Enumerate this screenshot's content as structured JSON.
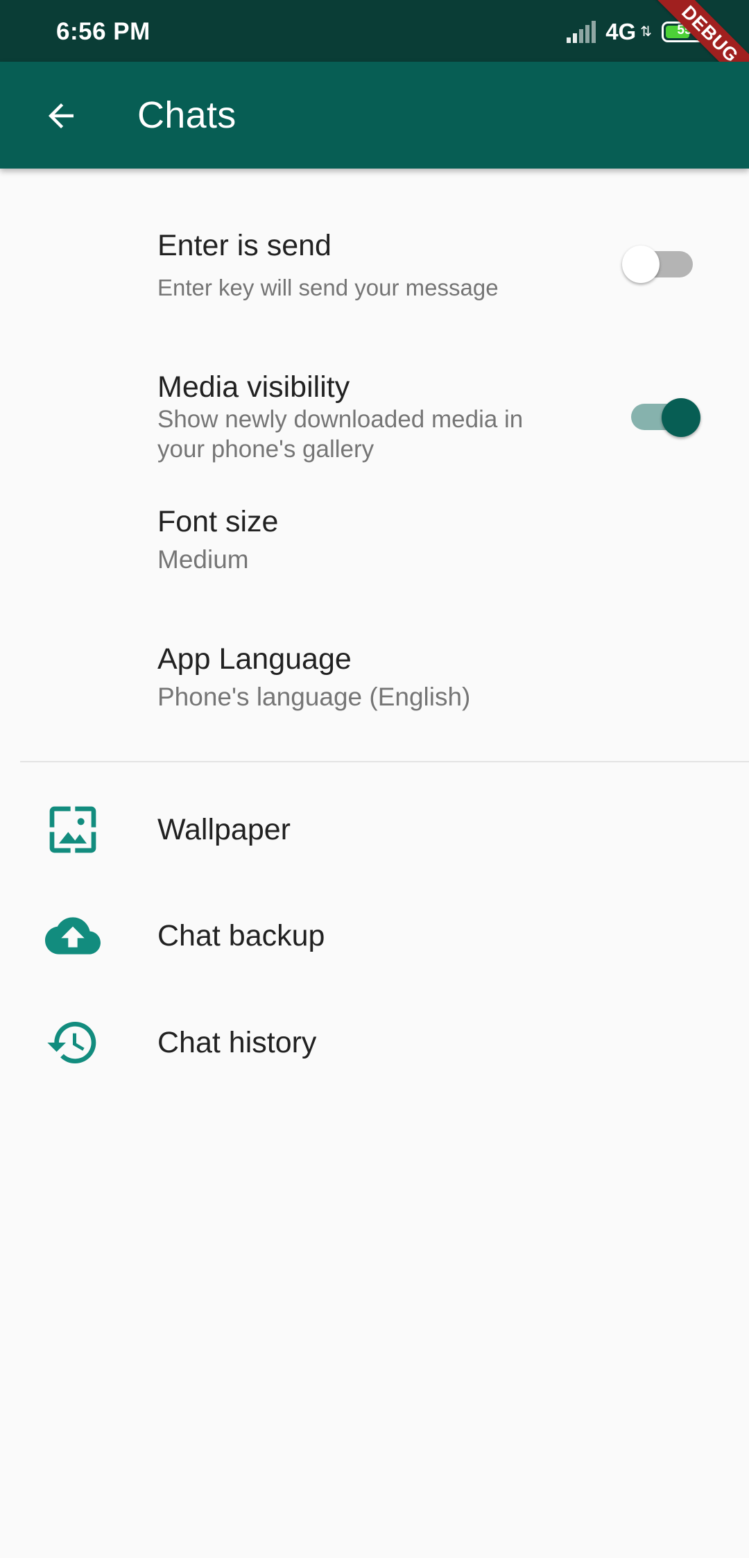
{
  "status_bar": {
    "time": "6:56 PM",
    "network": "4G",
    "battery": "55",
    "debug_banner": "DEBUG"
  },
  "app_bar": {
    "title": "Chats",
    "back_icon": "arrow-back-icon"
  },
  "settings": {
    "enter_is_send": {
      "title": "Enter is send",
      "subtitle": "Enter key will send your message",
      "enabled": false
    },
    "media_visibility": {
      "title": "Media visibility",
      "subtitle_line1": "Show newly downloaded media in",
      "subtitle_line2": "your phone's gallery",
      "enabled": true
    },
    "font_size": {
      "title": "Font size",
      "value": "Medium"
    },
    "app_language": {
      "title": "App Language",
      "value": "Phone's language (English)"
    }
  },
  "links": [
    {
      "label": "Wallpaper",
      "icon": "wallpaper-icon"
    },
    {
      "label": "Chat backup",
      "icon": "cloud-upload-icon"
    },
    {
      "label": "Chat history",
      "icon": "history-icon"
    }
  ],
  "colors": {
    "status_bar": "#0a3d36",
    "app_bar": "#075e54",
    "accent": "#128c7e",
    "switch_on_track": "#86b2ad",
    "switch_on_thumb": "#075e54",
    "switch_off_track": "#b4b4b4",
    "switch_off_thumb": "#ffffff",
    "debug_banner": "#a0201f"
  }
}
